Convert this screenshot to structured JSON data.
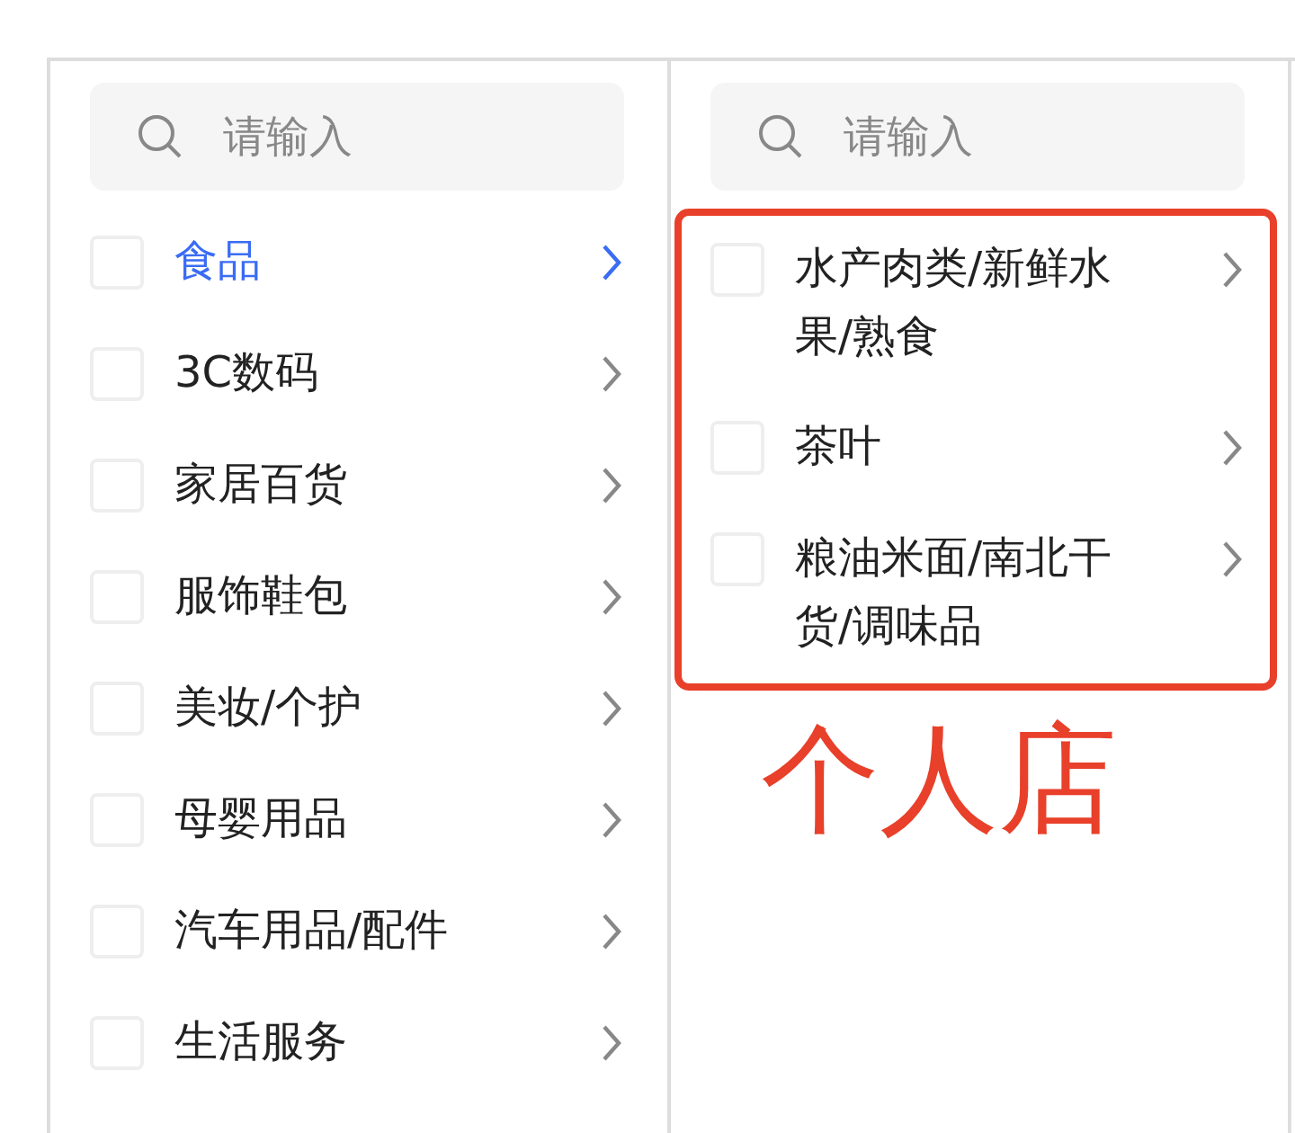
{
  "columns": [
    {
      "search": {
        "placeholder": "请输入"
      },
      "highlighted": false,
      "items": [
        {
          "label": "食品",
          "selected": true,
          "checked": false
        },
        {
          "label": "3C数码",
          "selected": false,
          "checked": false
        },
        {
          "label": "家居百货",
          "selected": false,
          "checked": false
        },
        {
          "label": "服饰鞋包",
          "selected": false,
          "checked": false
        },
        {
          "label": "美妆/个护",
          "selected": false,
          "checked": false
        },
        {
          "label": "母婴用品",
          "selected": false,
          "checked": false
        },
        {
          "label": "汽车用品/配件",
          "selected": false,
          "checked": false
        },
        {
          "label": "生活服务",
          "selected": false,
          "checked": false
        }
      ]
    },
    {
      "search": {
        "placeholder": "请输入"
      },
      "highlighted": true,
      "items": [
        {
          "label": "水产肉类/新鲜水果/熟食",
          "selected": false,
          "checked": false
        },
        {
          "label": "茶叶",
          "selected": false,
          "checked": false
        },
        {
          "label": "粮油米面/南北干货/调味品",
          "selected": false,
          "checked": false
        }
      ]
    }
  ],
  "annotation": {
    "text": "个人店"
  }
}
